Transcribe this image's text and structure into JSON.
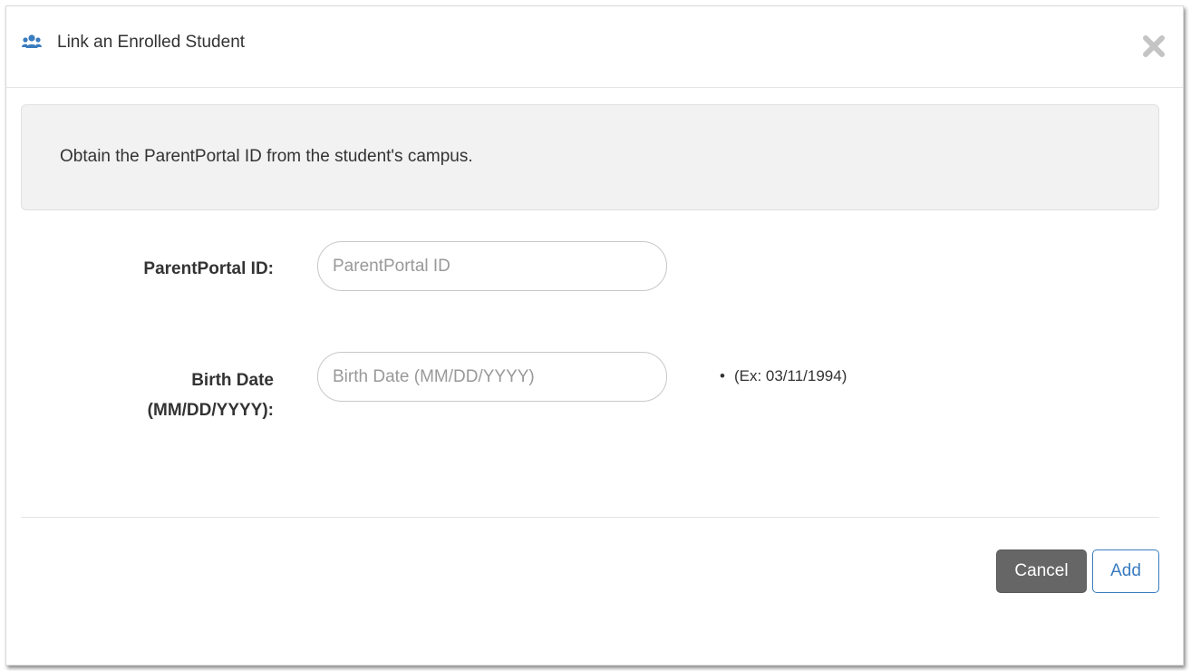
{
  "dialog": {
    "title": "Link an Enrolled Student",
    "header_icon": "users-icon",
    "close_icon": "close-icon"
  },
  "info": {
    "message": "Obtain the ParentPortal ID from the student's campus."
  },
  "form": {
    "parentportal_id": {
      "label": "ParentPortal ID:",
      "placeholder": "ParentPortal ID",
      "value": ""
    },
    "birth_date": {
      "label_line1": "Birth Date",
      "label_line2": "(MM/DD/YYYY):",
      "placeholder": "Birth Date (MM/DD/YYYY)",
      "value": "",
      "hint": "(Ex: 03/11/1994)"
    }
  },
  "footer": {
    "cancel_label": "Cancel",
    "add_label": "Add"
  },
  "colors": {
    "icon_blue": "#3a7cbf",
    "cancel_bg": "#666666",
    "info_bg": "#f2f2f2"
  }
}
